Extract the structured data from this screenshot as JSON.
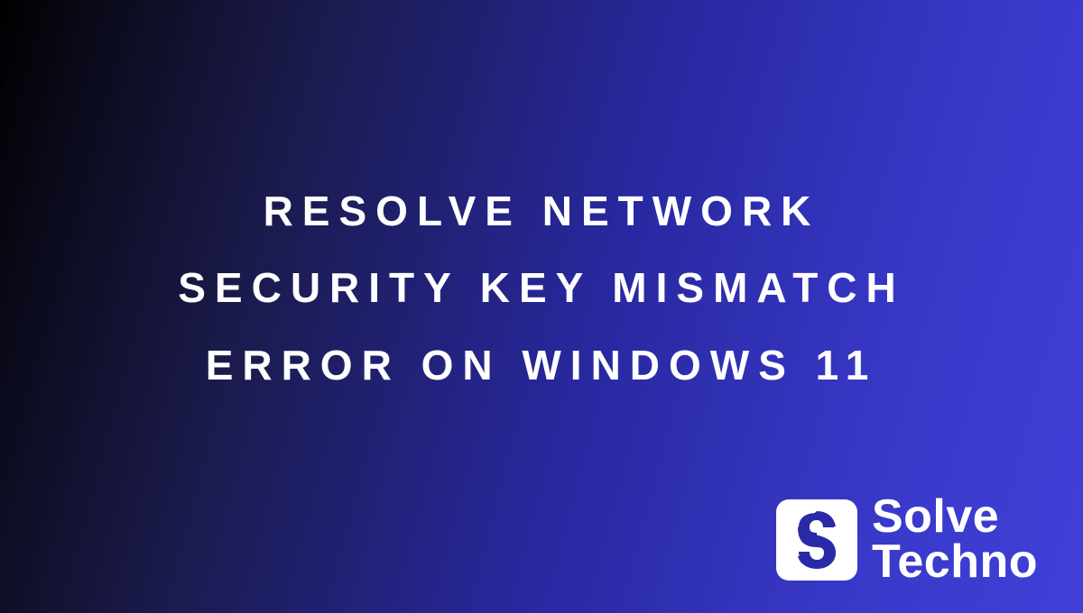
{
  "headline": {
    "text": "RESOLVE NETWORK SECURITY KEY MISMATCH ERROR ON WINDOWS 11"
  },
  "brand": {
    "name_line1": "Solve",
    "name_line2": "Techno",
    "logo_bg": "#ffffff",
    "logo_fg": "#2a2aa8"
  },
  "colors": {
    "gradient_start": "#000000",
    "gradient_end": "#4040d8",
    "text": "#ffffff"
  }
}
